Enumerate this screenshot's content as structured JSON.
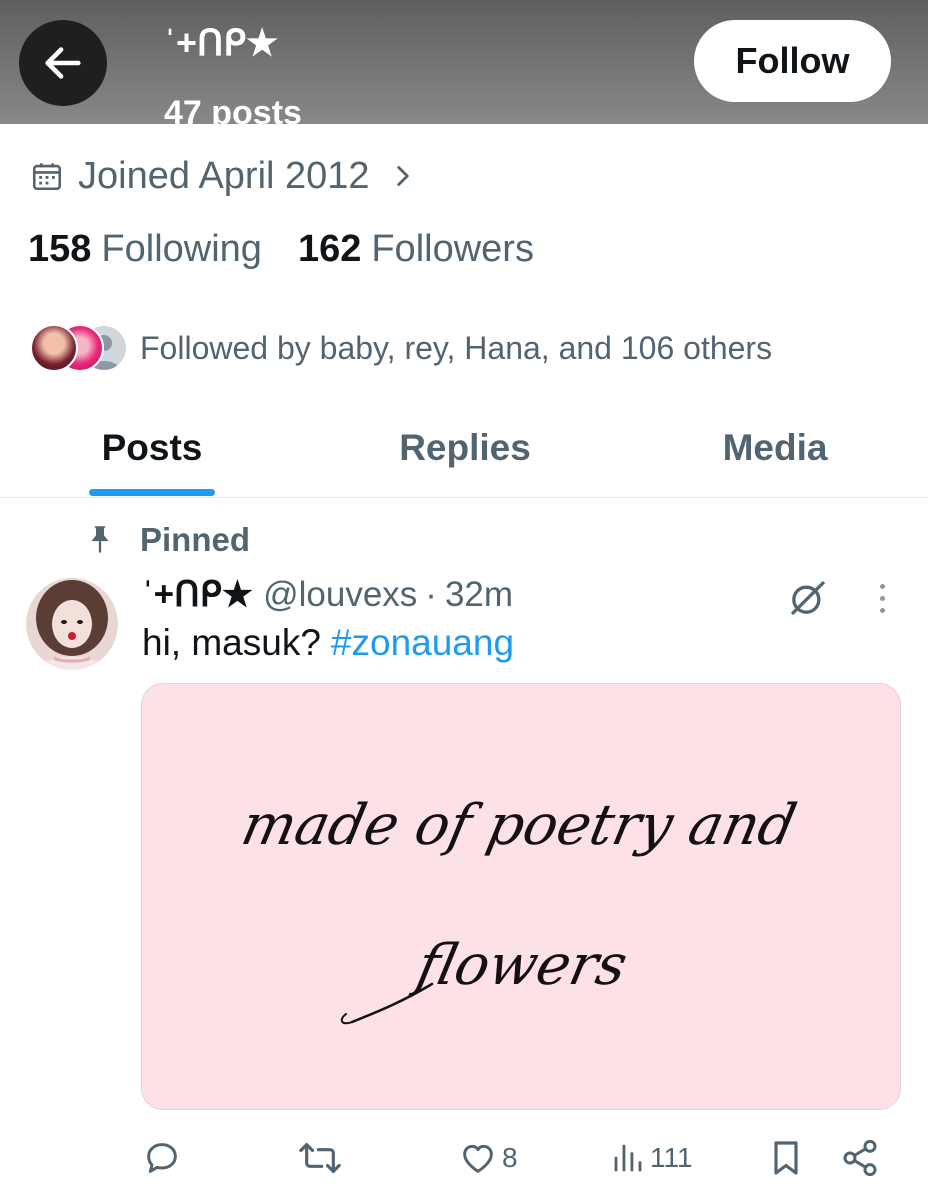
{
  "header": {
    "display_name": "ˈ+ᑎᑭ★",
    "posts_count": "47 posts",
    "follow_label": "Follow"
  },
  "profile": {
    "joined": "Joined April 2012",
    "following_count": "158",
    "following_label": "Following",
    "followers_count": "162",
    "followers_label": "Followers",
    "followed_by": "Followed by baby, rey, Hana, and 106 others"
  },
  "tabs": [
    {
      "label": "Posts",
      "active": true
    },
    {
      "label": "Replies",
      "active": false
    },
    {
      "label": "Media",
      "active": false
    }
  ],
  "post": {
    "pinned_label": "Pinned",
    "name": "ˈ+ᑎᑭ★",
    "handle": "@louvexs",
    "separator": "·",
    "time": "32m",
    "text": "hi, masuk?",
    "hashtag": "#zonauang",
    "image_text_line1": "made of poetry and",
    "image_text_line2": "flowers",
    "like_count": "8",
    "view_count": "111"
  },
  "colors": {
    "accent": "#1d9bf0",
    "secondary_text": "#536471",
    "primary_text": "#0f1419",
    "media_bg": "#fce1e6"
  },
  "icons": [
    "back-arrow-icon",
    "calendar-icon",
    "chevron-right-icon",
    "pin-icon",
    "grok-icon",
    "more-icon",
    "reply-icon",
    "repost-icon",
    "like-icon",
    "views-icon",
    "bookmark-icon",
    "share-icon"
  ]
}
